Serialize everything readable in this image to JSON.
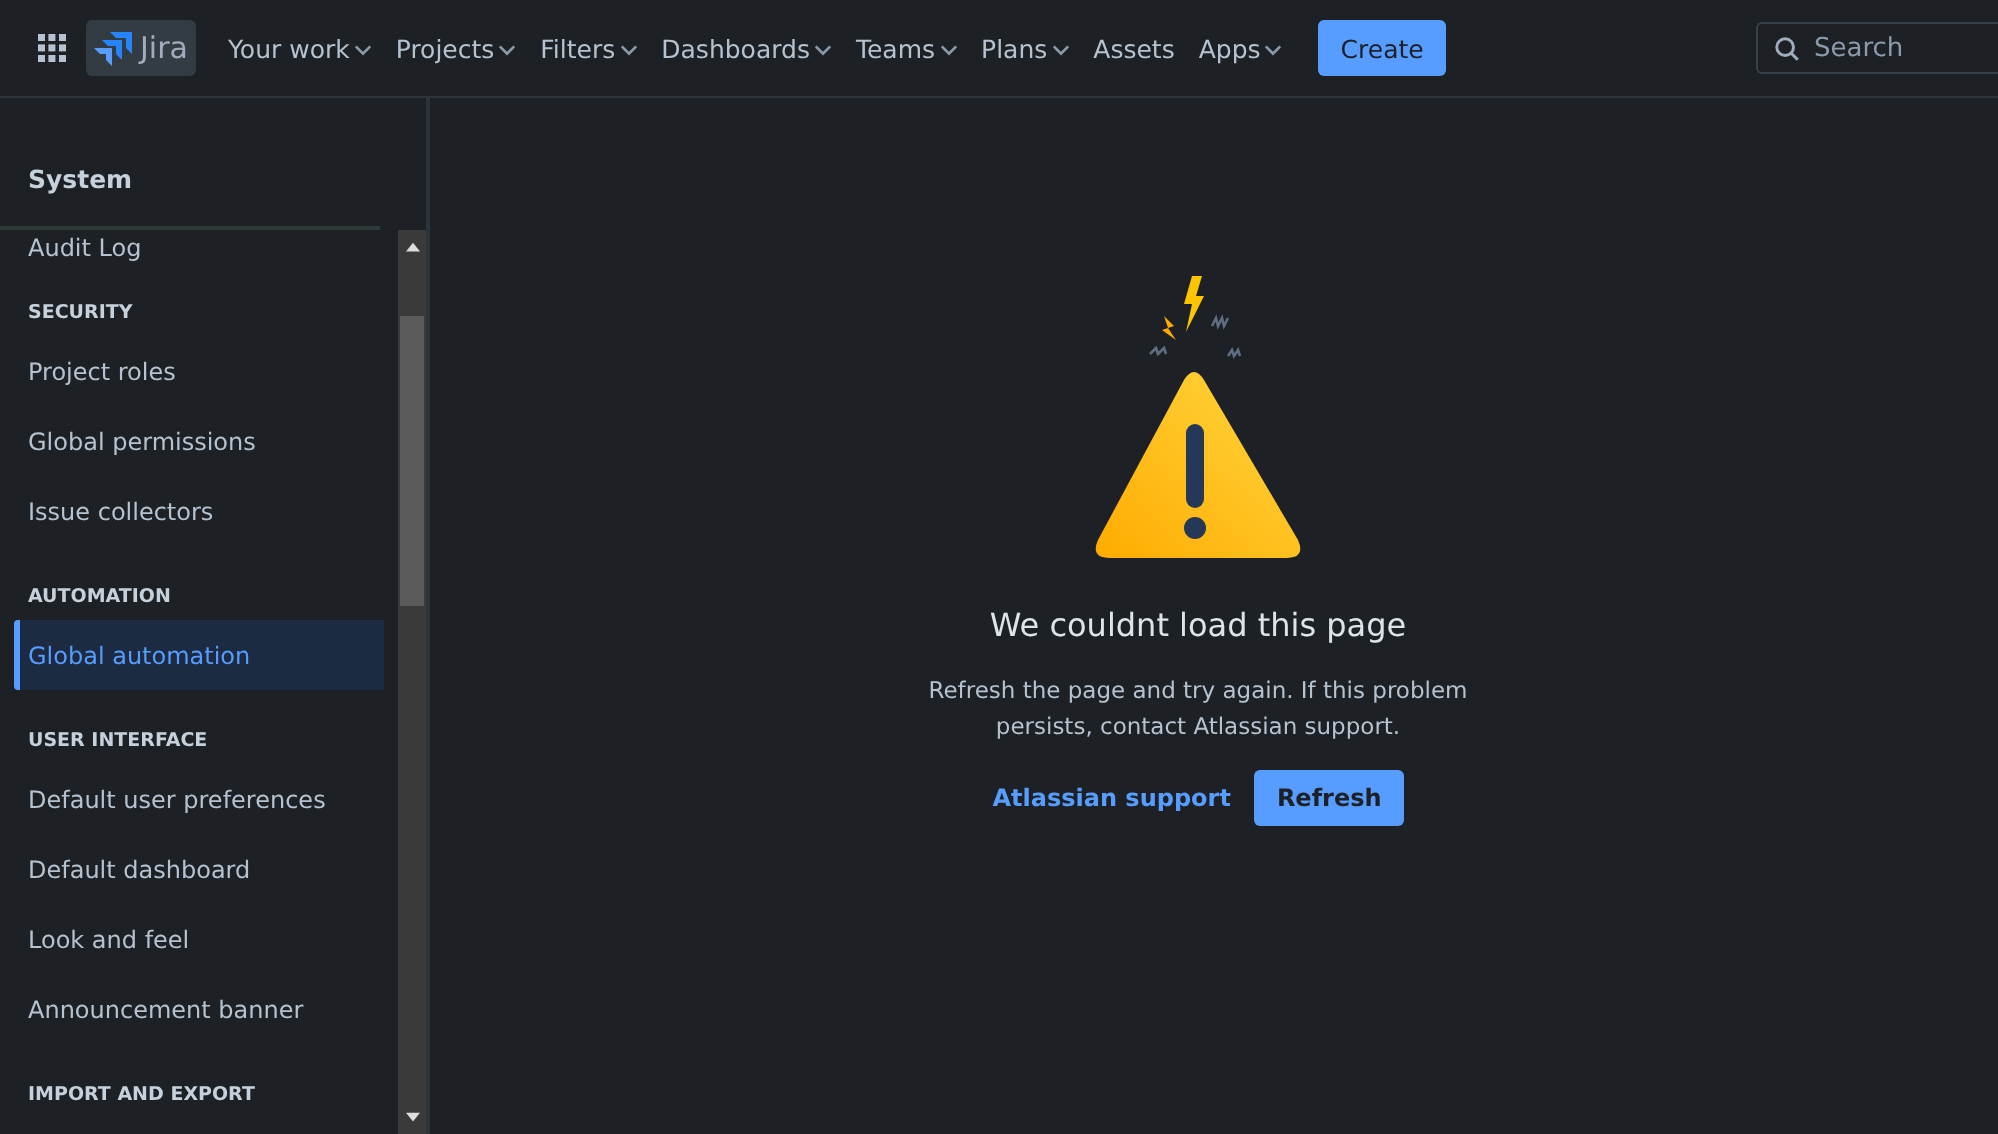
{
  "header": {
    "logo": "Jira",
    "nav": [
      {
        "label": "Your work",
        "has_menu": true
      },
      {
        "label": "Projects",
        "has_menu": true
      },
      {
        "label": "Filters",
        "has_menu": true
      },
      {
        "label": "Dashboards",
        "has_menu": true
      },
      {
        "label": "Teams",
        "has_menu": true
      },
      {
        "label": "Plans",
        "has_menu": true
      },
      {
        "label": "Assets",
        "has_menu": false
      },
      {
        "label": "Apps",
        "has_menu": true
      }
    ],
    "create_button": "Create",
    "search": {
      "placeholder": "Search"
    }
  },
  "sidebar": {
    "title": "System",
    "items": [
      {
        "kind": "item",
        "label": "Audit Log",
        "selected": false
      },
      {
        "kind": "heading",
        "label": "SECURITY"
      },
      {
        "kind": "item",
        "label": "Project roles",
        "selected": false
      },
      {
        "kind": "item",
        "label": "Global permissions",
        "selected": false
      },
      {
        "kind": "item",
        "label": "Issue collectors",
        "selected": false
      },
      {
        "kind": "heading",
        "label": "AUTOMATION"
      },
      {
        "kind": "item",
        "label": "Global automation",
        "selected": true
      },
      {
        "kind": "heading",
        "label": "USER INTERFACE"
      },
      {
        "kind": "item",
        "label": "Default user preferences",
        "selected": false
      },
      {
        "kind": "item",
        "label": "Default dashboard",
        "selected": false
      },
      {
        "kind": "item",
        "label": "Look and feel",
        "selected": false
      },
      {
        "kind": "item",
        "label": "Announcement banner",
        "selected": false
      },
      {
        "kind": "heading",
        "label": "IMPORT AND EXPORT"
      }
    ]
  },
  "error": {
    "title": "We couldnt load this page",
    "message": "Refresh the page and try again. If this problem persists, contact Atlassian support.",
    "link": "Atlassian support",
    "button": "Refresh"
  }
}
